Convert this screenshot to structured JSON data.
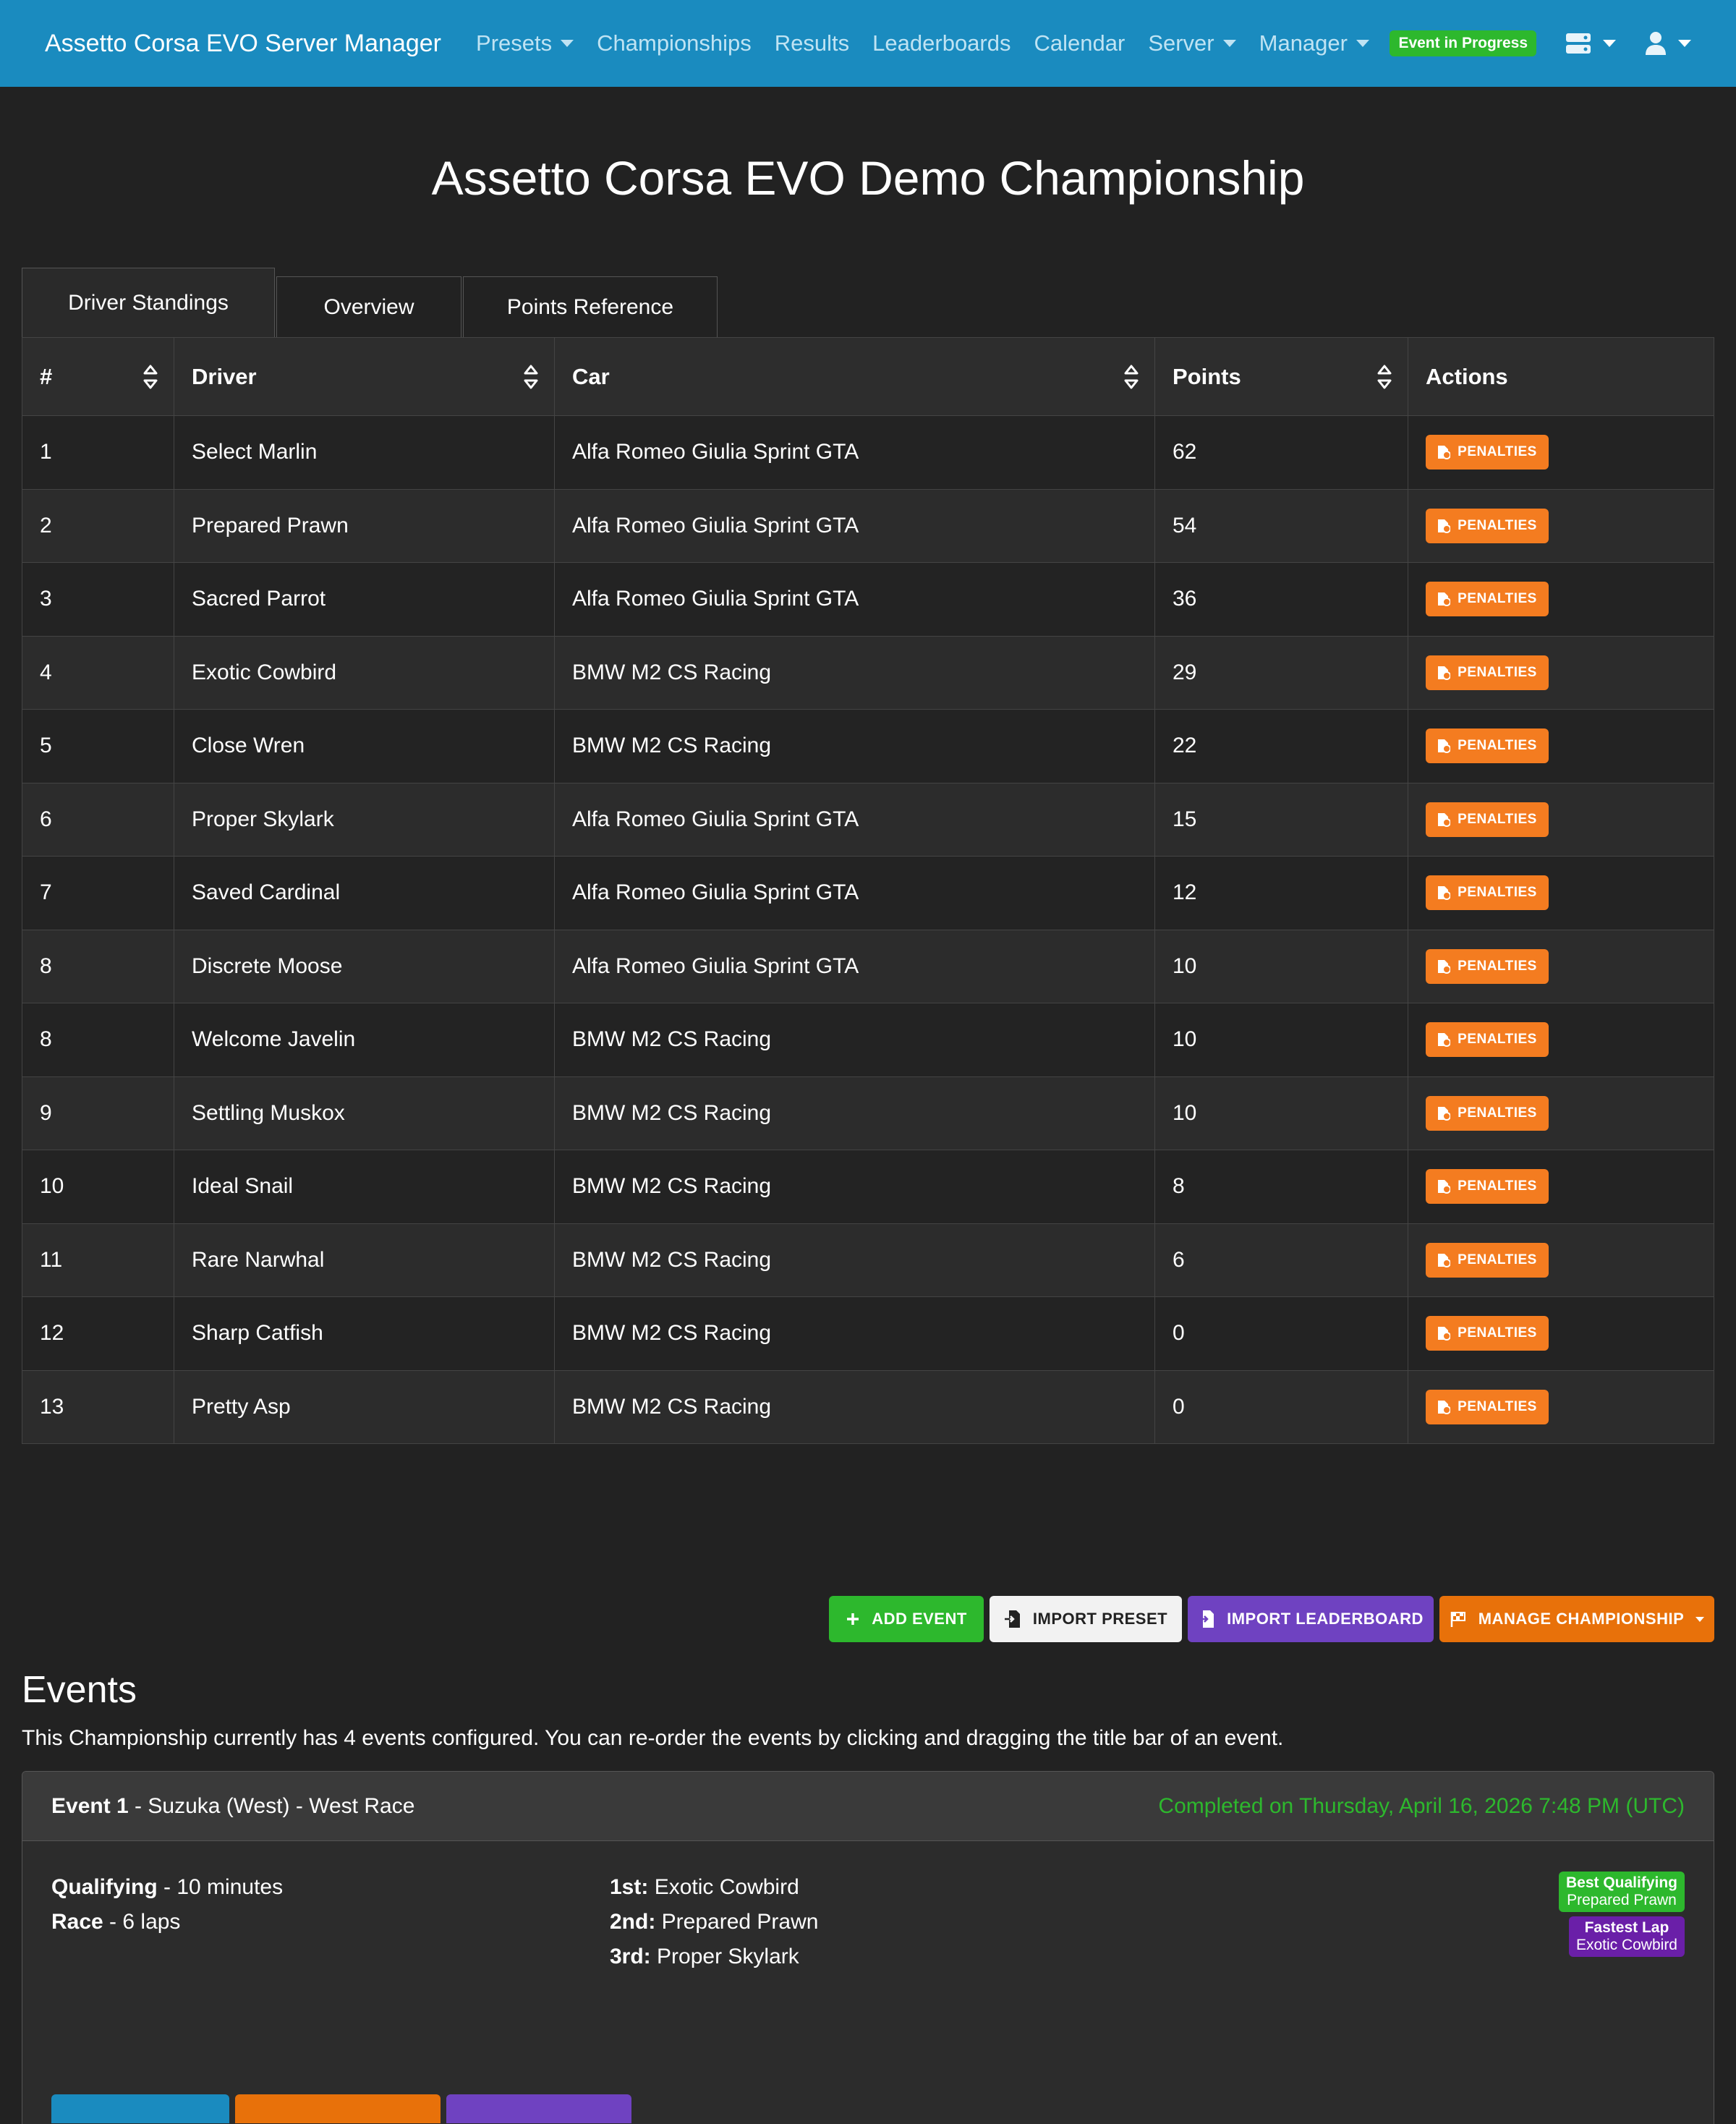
{
  "navbar": {
    "brand": "Assetto Corsa EVO Server Manager",
    "links": [
      {
        "label": "Presets",
        "dropdown": true
      },
      {
        "label": "Championships",
        "dropdown": false
      },
      {
        "label": "Results",
        "dropdown": false
      },
      {
        "label": "Leaderboards",
        "dropdown": false
      },
      {
        "label": "Calendar",
        "dropdown": false
      },
      {
        "label": "Server",
        "dropdown": true
      },
      {
        "label": "Manager",
        "dropdown": true
      }
    ],
    "status": "Event in Progress",
    "server_icon": "server-icon",
    "user_icon": "user-icon"
  },
  "page_title": "Assetto Corsa EVO Demo Championship",
  "tabs": [
    "Driver Standings",
    "Overview",
    "Points Reference"
  ],
  "standings": {
    "headers": [
      "#",
      "Driver",
      "Car",
      "Points",
      "Actions"
    ],
    "action_label": "PENALTIES",
    "rows": [
      {
        "pos": "1",
        "driver": "Select Marlin",
        "car": "Alfa Romeo Giulia Sprint GTA",
        "points": "62"
      },
      {
        "pos": "2",
        "driver": "Prepared Prawn",
        "car": "Alfa Romeo Giulia Sprint GTA",
        "points": "54"
      },
      {
        "pos": "3",
        "driver": "Sacred Parrot",
        "car": "Alfa Romeo Giulia Sprint GTA",
        "points": "36"
      },
      {
        "pos": "4",
        "driver": "Exotic Cowbird",
        "car": "BMW M2 CS Racing",
        "points": "29"
      },
      {
        "pos": "5",
        "driver": "Close Wren",
        "car": "BMW M2 CS Racing",
        "points": "22"
      },
      {
        "pos": "6",
        "driver": "Proper Skylark",
        "car": "Alfa Romeo Giulia Sprint GTA",
        "points": "15"
      },
      {
        "pos": "7",
        "driver": "Saved Cardinal",
        "car": "Alfa Romeo Giulia Sprint GTA",
        "points": "12"
      },
      {
        "pos": "8",
        "driver": "Discrete Moose",
        "car": "Alfa Romeo Giulia Sprint GTA",
        "points": "10"
      },
      {
        "pos": "8",
        "driver": "Welcome Javelin",
        "car": "BMW M2 CS Racing",
        "points": "10"
      },
      {
        "pos": "9",
        "driver": "Settling Muskox",
        "car": "BMW M2 CS Racing",
        "points": "10"
      },
      {
        "pos": "10",
        "driver": "Ideal Snail",
        "car": "BMW M2 CS Racing",
        "points": "8"
      },
      {
        "pos": "11",
        "driver": "Rare Narwhal",
        "car": "BMW M2 CS Racing",
        "points": "6"
      },
      {
        "pos": "12",
        "driver": "Sharp Catfish",
        "car": "BMW M2 CS Racing",
        "points": "0"
      },
      {
        "pos": "13",
        "driver": "Pretty Asp",
        "car": "BMW M2 CS Racing",
        "points": "0"
      }
    ]
  },
  "actions": {
    "add_event": "ADD EVENT",
    "import_preset": "IMPORT PRESET",
    "import_leaderboard": "IMPORT LEADERBOARD",
    "manage_championship": "MANAGE CHAMPIONSHIP"
  },
  "events": {
    "heading": "Events",
    "description": "This Championship currently has 4 events configured. You can re-order the events by clicking and dragging the title bar of an event.",
    "items": [
      {
        "number": "Event 1",
        "title": " - Suzuka (West) - West Race",
        "completed": "Completed on Thursday, April 16, 2026 7:48 PM (UTC)",
        "sessions": [
          {
            "name": "Qualifying",
            "detail": " - 10 minutes"
          },
          {
            "name": "Race",
            "detail": " - 6 laps"
          }
        ],
        "podium": [
          {
            "place": "1st:",
            "driver": " Exotic Cowbird"
          },
          {
            "place": "2nd:",
            "driver": " Prepared Prawn"
          },
          {
            "place": "3rd:",
            "driver": " Proper Skylark"
          }
        ],
        "badges": [
          {
            "title": "Best Qualifying",
            "driver": "Prepared Prawn",
            "color": "#2db82d"
          },
          {
            "title": "Fastest Lap",
            "driver": "Exotic Cowbird",
            "color": "#6a1fa8"
          }
        ]
      }
    ]
  },
  "colors": {
    "navbar": "#1a8bbf",
    "background": "#222222",
    "penalty": "#f47c20",
    "success": "#2db82d",
    "purple": "#6f42c1",
    "orange": "#e8710a"
  }
}
